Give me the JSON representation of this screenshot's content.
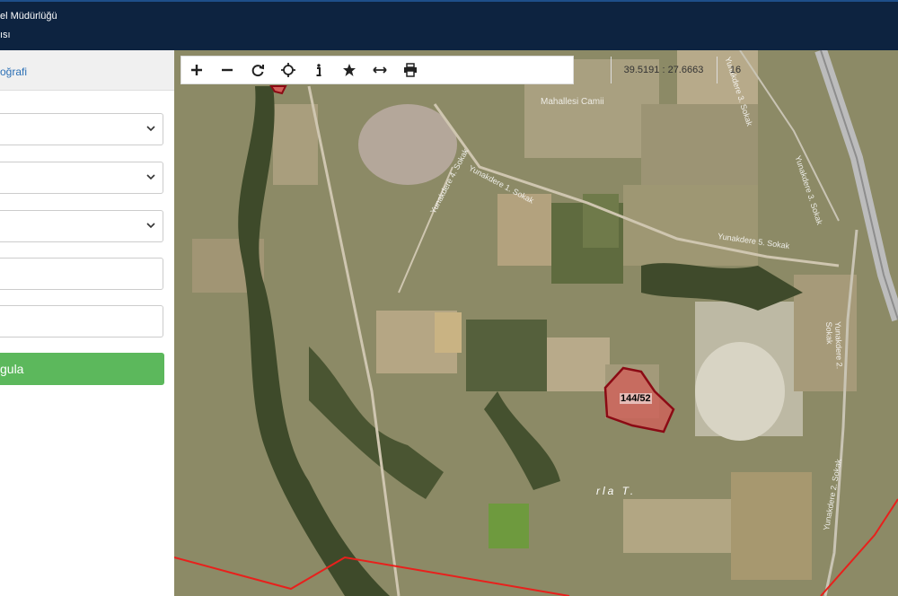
{
  "header": {
    "title_line1": "el Müdürlüğü",
    "title_line2": "ısı"
  },
  "sidebar": {
    "tab_label": "oğrafi",
    "button_label": "gula",
    "dropdowns": [
      "",
      "",
      ""
    ],
    "inputs": [
      "",
      ""
    ]
  },
  "toolbar": {
    "coordinates": "39.5191 : 27.6663",
    "zoom_level": "16"
  },
  "map": {
    "parcel_label": "144/52",
    "place_label": "rla T.",
    "mahalle_label": "Mahallesi Camii",
    "streets": {
      "s1": "Yunakdere 1. Sokak",
      "s2": "Yunakdere 4. Sokak",
      "s3": "Yunakdere 5. Sokak",
      "s4": "Yunakdere 3. Sokak",
      "s5": "Yunakdere 2. Sokak",
      "s6": "Yunakdere 2. Sokak",
      "s7": "Yunakdere 3. Sokak"
    },
    "colors": {
      "parcel_fill": "#d0605a",
      "parcel_stroke": "#8b0a14",
      "boundary_line": "#e8201c"
    }
  },
  "colors": {
    "header_bg": "#0d2340",
    "button_bg": "#5cb85c",
    "tab_text": "#2a6fb5"
  }
}
